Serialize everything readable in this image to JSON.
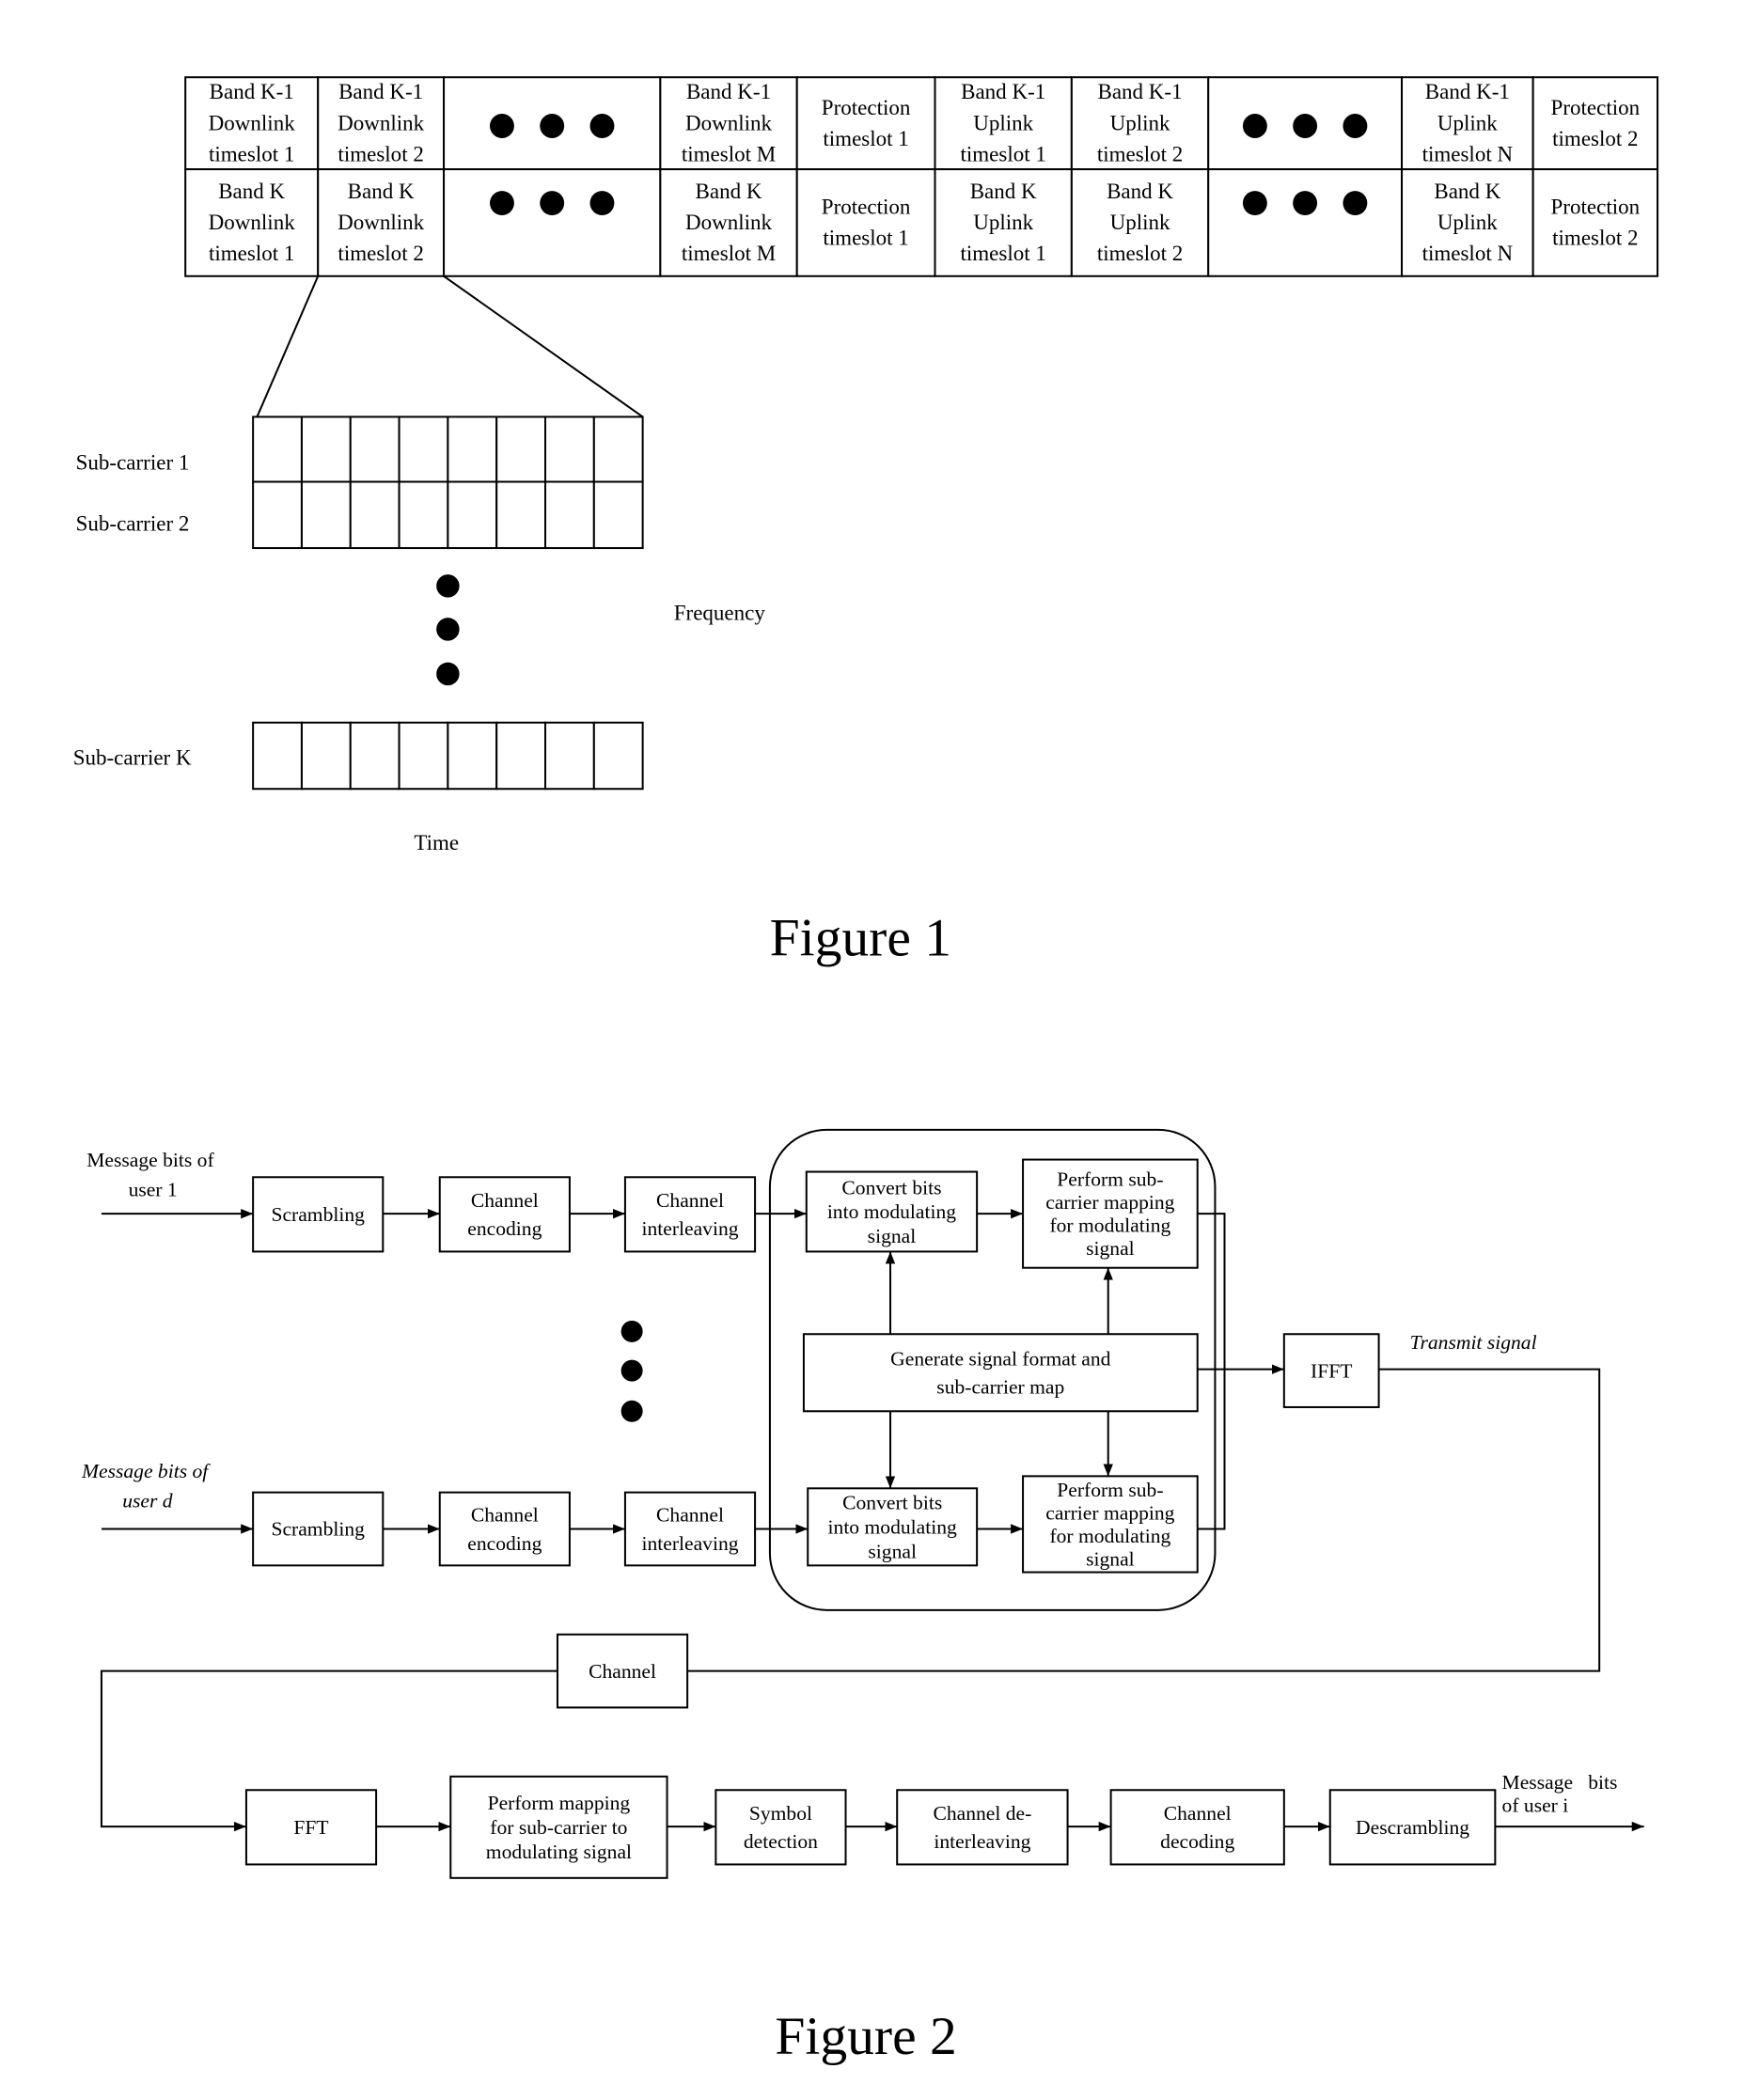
{
  "figure1": {
    "caption": "Figure 1",
    "table": {
      "rows": [
        [
          {
            "lines": [
              "Band K-1",
              "Downlink",
              "timeslot 1"
            ]
          },
          {
            "lines": [
              "Band K-1",
              "Downlink",
              "timeslot 2"
            ]
          },
          {
            "ellipsis": true
          },
          {
            "lines": [
              "Band K-1",
              "Downlink",
              "timeslot M"
            ]
          },
          {
            "lines": [
              "Protection",
              "timeslot 1"
            ]
          },
          {
            "lines": [
              "Band K-1",
              "Uplink",
              "timeslot 1"
            ]
          },
          {
            "lines": [
              "Band K-1",
              "Uplink",
              "timeslot 2"
            ]
          },
          {
            "ellipsis": true
          },
          {
            "lines": [
              "Band K-1",
              "Uplink",
              "timeslot N"
            ]
          },
          {
            "lines": [
              "Protection",
              "timeslot 2"
            ]
          }
        ],
        [
          {
            "lines": [
              "Band K",
              "Downlink",
              "timeslot 1"
            ]
          },
          {
            "lines": [
              "Band K",
              "Downlink",
              "timeslot 2"
            ]
          },
          {
            "ellipsis": true
          },
          {
            "lines": [
              "Band K",
              "Downlink",
              "timeslot M"
            ]
          },
          {
            "lines": [
              "Protection",
              "timeslot 1"
            ]
          },
          {
            "lines": [
              "Band K",
              "Uplink",
              "timeslot 1"
            ]
          },
          {
            "lines": [
              "Band K",
              "Uplink",
              "timeslot 2"
            ]
          },
          {
            "ellipsis": true
          },
          {
            "lines": [
              "Band K",
              "Uplink",
              "timeslot N"
            ]
          },
          {
            "lines": [
              "Protection",
              "timeslot 2"
            ]
          }
        ]
      ]
    },
    "subcarriers": {
      "labels": [
        "Sub-carrier 1",
        "Sub-carrier 2",
        "Sub-carrier K"
      ],
      "cells_per_row": 8,
      "frequency_label": "Frequency",
      "time_label": "Time"
    }
  },
  "figure2": {
    "caption": "Figure 2",
    "inputs": {
      "user1": [
        "Message bits of",
        "user 1"
      ],
      "userd": [
        "Message bits of",
        "user d"
      ]
    },
    "tx_chain": {
      "scrambling": [
        "Scrambling"
      ],
      "channel_encoding": [
        "Channel",
        "encoding"
      ],
      "channel_interleaving": [
        "Channel",
        "interleaving"
      ],
      "convert": [
        "Convert bits",
        "into modulating",
        "signal"
      ],
      "perform_mapping": [
        "Perform sub-",
        "carrier mapping",
        "for modulating",
        "signal"
      ],
      "generate": [
        "Generate signal format and",
        "sub-carrier map"
      ],
      "ifft": [
        "IFFT"
      ],
      "transmit_label": "Transmit signal"
    },
    "channel": [
      "Channel"
    ],
    "rx_chain": {
      "fft": [
        "FFT"
      ],
      "perform_mapping": [
        "Perform mapping",
        "for sub-carrier to",
        "modulating signal"
      ],
      "symbol_detection": [
        "Symbol",
        "detection"
      ],
      "channel_deinterleaving": [
        "Channel de-",
        "interleaving"
      ],
      "channel_decoding": [
        "Channel",
        "decoding"
      ],
      "descrambling": [
        "Descrambling"
      ],
      "output_label": [
        "Message   bits",
        "of user i"
      ]
    }
  }
}
